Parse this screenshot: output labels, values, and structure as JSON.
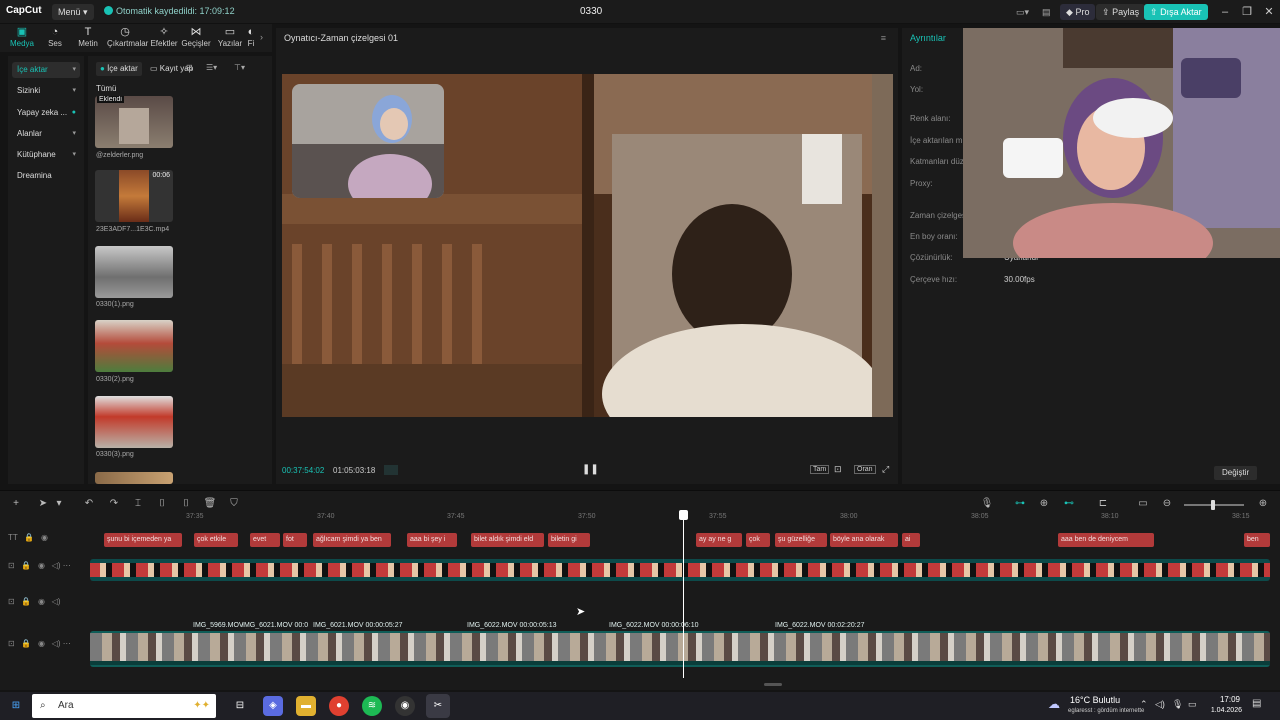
{
  "titlebar": {
    "logo": "CapCut",
    "menu_label": "Menü",
    "autosave": "Otomatik kaydedildi: 17:09:12",
    "project_name": "0330",
    "pro_label": "Pro",
    "share_label": "Paylaş",
    "export_label": "Dışa Aktar"
  },
  "tool_tabs": [
    {
      "label": "Medya",
      "icon": "media-icon"
    },
    {
      "label": "Ses",
      "icon": "audio-icon"
    },
    {
      "label": "Metin",
      "icon": "text-icon"
    },
    {
      "label": "Çıkartmalar",
      "icon": "sticker-icon"
    },
    {
      "label": "Efektler",
      "icon": "effects-icon"
    },
    {
      "label": "Geçişler",
      "icon": "transitions-icon"
    },
    {
      "label": "Yazılar",
      "icon": "captions-icon"
    },
    {
      "label": "Fi",
      "icon": "filter-icon"
    }
  ],
  "sidenav": [
    {
      "label": "İçe aktar"
    },
    {
      "label": "Sizinki"
    },
    {
      "label": "Yapay zeka ..."
    },
    {
      "label": "Alanlar"
    },
    {
      "label": "Kütüphane"
    },
    {
      "label": "Dreamina"
    }
  ],
  "media": {
    "import_label": "İçe aktar",
    "record_label": "Kayıt yap",
    "all_label": "Tümü",
    "added_badge": "Eklendi",
    "items": [
      {
        "name": "@zelderler.png"
      },
      {
        "name": "23E3ADF7...1E3C.mp4",
        "duration": "00:06"
      },
      {
        "name": "0330(1).png"
      },
      {
        "name": "0330(2).png"
      },
      {
        "name": "0330(3).png"
      }
    ]
  },
  "player": {
    "title": "Oynatıcı-Zaman çizelgesi 01",
    "current_time": "00:37:54:02",
    "total_time": "01:05:03:18",
    "full_label": "Tam",
    "ratio_label": "Oran"
  },
  "details": {
    "title": "Ayrıntılar",
    "rows": [
      {
        "label": "Ad:",
        "value": ""
      },
      {
        "label": "Yol:",
        "value": ""
      },
      {
        "label": "Renk alanı:",
        "value": ""
      },
      {
        "label": "İçe aktarılan m...",
        "value": ""
      },
      {
        "label": "Katmanları düz...",
        "value": ""
      },
      {
        "label": "Proxy:",
        "value": ""
      },
      {
        "label": "Zaman çizelges...",
        "value": ""
      },
      {
        "label": "En boy oranı:",
        "value": ""
      },
      {
        "label": "Çözünürlük:",
        "value": "Uyarlandı"
      },
      {
        "label": "Çerçeve hızı:",
        "value": "30.00fps"
      }
    ],
    "change_label": "Değiştir"
  },
  "timeline": {
    "ticks": [
      "37:35",
      "37:40",
      "37:45",
      "37:50",
      "37:55",
      "38:00",
      "38:05",
      "38:10",
      "38:15"
    ],
    "captions": [
      "şunu bi içemeden ya",
      "çok etkile",
      "evet",
      "fot",
      "ağlıcam şimdi ya ben",
      "aaa bi şey i",
      "bilet aldık şimdi eld",
      "biletin gi",
      "ay ay ne g",
      "çok",
      "şu güzelliğe",
      "böyle ana olarak",
      "ai",
      "aaa ben de deniycem",
      "ben"
    ],
    "video_clips": [
      {
        "label": "IMG_5969.MOV"
      },
      {
        "label": "IMG_6021.MOV  00:0"
      },
      {
        "label": "IMG_6021.MOV  00:00:05:27"
      },
      {
        "label": "IMG_6022.MOV  00:00:05:13"
      },
      {
        "label": "IMG_6022.MOV  00:00:06:10"
      },
      {
        "label": "IMG_6022.MOV  00:02:20:27"
      }
    ]
  },
  "taskbar": {
    "search_placeholder": "Ara",
    "weather_temp": "16°C",
    "weather_desc": "Bulutlu",
    "ticker": "eglaresst : gördüm internette",
    "time": "17:09",
    "date": "1.04.2026"
  },
  "colors": {
    "accent": "#19c2b5",
    "caption": "#b23a3a",
    "track": "#0f5d58"
  }
}
